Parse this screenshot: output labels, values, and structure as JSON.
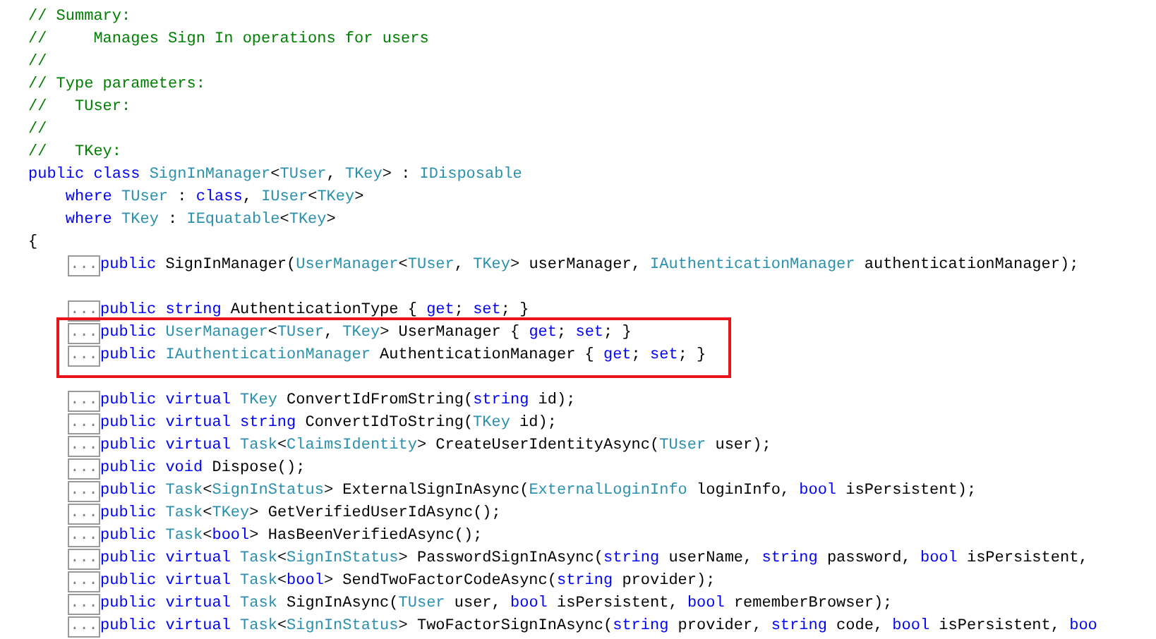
{
  "lines": [
    {
      "kind": "code",
      "tokens": [
        {
          "kind": "comment",
          "text": "// Summary:"
        }
      ]
    },
    {
      "kind": "code",
      "tokens": [
        {
          "kind": "comment",
          "text": "//     Manages Sign In operations for users"
        }
      ]
    },
    {
      "kind": "code",
      "tokens": [
        {
          "kind": "comment",
          "text": "//"
        }
      ]
    },
    {
      "kind": "code",
      "tokens": [
        {
          "kind": "comment",
          "text": "// Type parameters:"
        }
      ]
    },
    {
      "kind": "code",
      "tokens": [
        {
          "kind": "comment",
          "text": "//   TUser:"
        }
      ]
    },
    {
      "kind": "code",
      "tokens": [
        {
          "kind": "comment",
          "text": "//"
        }
      ]
    },
    {
      "kind": "code",
      "tokens": [
        {
          "kind": "comment",
          "text": "//   TKey:"
        }
      ]
    },
    {
      "kind": "code",
      "tokens": [
        {
          "kind": "keyword",
          "text": "public class "
        },
        {
          "kind": "type",
          "text": "SignInManager"
        },
        {
          "kind": "text",
          "text": "<"
        },
        {
          "kind": "type",
          "text": "TUser"
        },
        {
          "kind": "text",
          "text": ", "
        },
        {
          "kind": "type",
          "text": "TKey"
        },
        {
          "kind": "text",
          "text": "> : "
        },
        {
          "kind": "type",
          "text": "IDisposable"
        }
      ]
    },
    {
      "kind": "code",
      "tokens": [
        {
          "kind": "keyword",
          "text": "    where "
        },
        {
          "kind": "type",
          "text": "TUser"
        },
        {
          "kind": "text",
          "text": " : "
        },
        {
          "kind": "keyword",
          "text": "class"
        },
        {
          "kind": "text",
          "text": ", "
        },
        {
          "kind": "type",
          "text": "IUser"
        },
        {
          "kind": "text",
          "text": "<"
        },
        {
          "kind": "type",
          "text": "TKey"
        },
        {
          "kind": "text",
          "text": ">"
        }
      ]
    },
    {
      "kind": "code",
      "tokens": [
        {
          "kind": "keyword",
          "text": "    where "
        },
        {
          "kind": "type",
          "text": "TKey"
        },
        {
          "kind": "text",
          "text": " : "
        },
        {
          "kind": "type",
          "text": "IEquatable"
        },
        {
          "kind": "text",
          "text": "<"
        },
        {
          "kind": "type",
          "text": "TKey"
        },
        {
          "kind": "text",
          "text": ">"
        }
      ]
    },
    {
      "kind": "code",
      "tokens": [
        {
          "kind": "text",
          "text": "{"
        }
      ]
    },
    {
      "kind": "code",
      "fold": "...",
      "highlighted": false,
      "tokens": [
        {
          "kind": "keyword",
          "text": "public"
        },
        {
          "kind": "text",
          "text": " SignInManager("
        },
        {
          "kind": "type",
          "text": "UserManager"
        },
        {
          "kind": "text",
          "text": "<"
        },
        {
          "kind": "type",
          "text": "TUser"
        },
        {
          "kind": "text",
          "text": ", "
        },
        {
          "kind": "type",
          "text": "TKey"
        },
        {
          "kind": "text",
          "text": "> userManager, "
        },
        {
          "kind": "type",
          "text": "IAuthenticationManager"
        },
        {
          "kind": "text",
          "text": " authenticationManager);"
        }
      ]
    },
    {
      "kind": "blank"
    },
    {
      "kind": "code",
      "fold": "...",
      "highlighted": false,
      "tokens": [
        {
          "kind": "keyword",
          "text": "public string"
        },
        {
          "kind": "text",
          "text": " AuthenticationType { "
        },
        {
          "kind": "keyword",
          "text": "get"
        },
        {
          "kind": "text",
          "text": "; "
        },
        {
          "kind": "keyword",
          "text": "set"
        },
        {
          "kind": "text",
          "text": "; }"
        }
      ]
    },
    {
      "kind": "code",
      "fold": "...",
      "highlighted": true,
      "tokens": [
        {
          "kind": "keyword",
          "text": "public "
        },
        {
          "kind": "type",
          "text": "UserManager"
        },
        {
          "kind": "text",
          "text": "<"
        },
        {
          "kind": "type",
          "text": "TUser"
        },
        {
          "kind": "text",
          "text": ", "
        },
        {
          "kind": "type",
          "text": "TKey"
        },
        {
          "kind": "text",
          "text": "> UserManager { "
        },
        {
          "kind": "keyword",
          "text": "get"
        },
        {
          "kind": "text",
          "text": "; "
        },
        {
          "kind": "keyword",
          "text": "set"
        },
        {
          "kind": "text",
          "text": "; }"
        }
      ]
    },
    {
      "kind": "code",
      "fold": "...",
      "highlighted": true,
      "tokens": [
        {
          "kind": "keyword",
          "text": "public "
        },
        {
          "kind": "type",
          "text": "IAuthenticationManager"
        },
        {
          "kind": "text",
          "text": " AuthenticationManager { "
        },
        {
          "kind": "keyword",
          "text": "get"
        },
        {
          "kind": "text",
          "text": "; "
        },
        {
          "kind": "keyword",
          "text": "set"
        },
        {
          "kind": "text",
          "text": "; }"
        }
      ]
    },
    {
      "kind": "blank"
    },
    {
      "kind": "code",
      "fold": "...",
      "highlighted": false,
      "tokens": [
        {
          "kind": "keyword",
          "text": "public virtual "
        },
        {
          "kind": "type",
          "text": "TKey"
        },
        {
          "kind": "text",
          "text": " ConvertIdFromString("
        },
        {
          "kind": "keyword",
          "text": "string"
        },
        {
          "kind": "text",
          "text": " id);"
        }
      ]
    },
    {
      "kind": "code",
      "fold": "...",
      "highlighted": false,
      "tokens": [
        {
          "kind": "keyword",
          "text": "public virtual string"
        },
        {
          "kind": "text",
          "text": " ConvertIdToString("
        },
        {
          "kind": "type",
          "text": "TKey"
        },
        {
          "kind": "text",
          "text": " id);"
        }
      ]
    },
    {
      "kind": "code",
      "fold": "...",
      "highlighted": false,
      "tokens": [
        {
          "kind": "keyword",
          "text": "public virtual "
        },
        {
          "kind": "type",
          "text": "Task"
        },
        {
          "kind": "text",
          "text": "<"
        },
        {
          "kind": "type",
          "text": "ClaimsIdentity"
        },
        {
          "kind": "text",
          "text": "> CreateUserIdentityAsync("
        },
        {
          "kind": "type",
          "text": "TUser"
        },
        {
          "kind": "text",
          "text": " user);"
        }
      ]
    },
    {
      "kind": "code",
      "fold": "...",
      "highlighted": false,
      "tokens": [
        {
          "kind": "keyword",
          "text": "public void"
        },
        {
          "kind": "text",
          "text": " Dispose();"
        }
      ]
    },
    {
      "kind": "code",
      "fold": "...",
      "highlighted": false,
      "tokens": [
        {
          "kind": "keyword",
          "text": "public "
        },
        {
          "kind": "type",
          "text": "Task"
        },
        {
          "kind": "text",
          "text": "<"
        },
        {
          "kind": "type",
          "text": "SignInStatus"
        },
        {
          "kind": "text",
          "text": "> ExternalSignInAsync("
        },
        {
          "kind": "type",
          "text": "ExternalLoginInfo"
        },
        {
          "kind": "text",
          "text": " loginInfo, "
        },
        {
          "kind": "keyword",
          "text": "bool"
        },
        {
          "kind": "text",
          "text": " isPersistent);"
        }
      ]
    },
    {
      "kind": "code",
      "fold": "...",
      "highlighted": false,
      "tokens": [
        {
          "kind": "keyword",
          "text": "public "
        },
        {
          "kind": "type",
          "text": "Task"
        },
        {
          "kind": "text",
          "text": "<"
        },
        {
          "kind": "type",
          "text": "TKey"
        },
        {
          "kind": "text",
          "text": "> GetVerifiedUserIdAsync();"
        }
      ]
    },
    {
      "kind": "code",
      "fold": "...",
      "highlighted": false,
      "tokens": [
        {
          "kind": "keyword",
          "text": "public "
        },
        {
          "kind": "type",
          "text": "Task"
        },
        {
          "kind": "text",
          "text": "<"
        },
        {
          "kind": "keyword",
          "text": "bool"
        },
        {
          "kind": "text",
          "text": "> HasBeenVerifiedAsync();"
        }
      ]
    },
    {
      "kind": "code",
      "fold": "...",
      "highlighted": false,
      "tokens": [
        {
          "kind": "keyword",
          "text": "public virtual "
        },
        {
          "kind": "type",
          "text": "Task"
        },
        {
          "kind": "text",
          "text": "<"
        },
        {
          "kind": "type",
          "text": "SignInStatus"
        },
        {
          "kind": "text",
          "text": "> PasswordSignInAsync("
        },
        {
          "kind": "keyword",
          "text": "string"
        },
        {
          "kind": "text",
          "text": " userName, "
        },
        {
          "kind": "keyword",
          "text": "string"
        },
        {
          "kind": "text",
          "text": " password, "
        },
        {
          "kind": "keyword",
          "text": "bool"
        },
        {
          "kind": "text",
          "text": " isPersistent,"
        }
      ]
    },
    {
      "kind": "code",
      "fold": "...",
      "highlighted": false,
      "tokens": [
        {
          "kind": "keyword",
          "text": "public virtual "
        },
        {
          "kind": "type",
          "text": "Task"
        },
        {
          "kind": "text",
          "text": "<"
        },
        {
          "kind": "keyword",
          "text": "bool"
        },
        {
          "kind": "text",
          "text": "> SendTwoFactorCodeAsync("
        },
        {
          "kind": "keyword",
          "text": "string"
        },
        {
          "kind": "text",
          "text": " provider);"
        }
      ]
    },
    {
      "kind": "code",
      "fold": "...",
      "highlighted": false,
      "tokens": [
        {
          "kind": "keyword",
          "text": "public virtual "
        },
        {
          "kind": "type",
          "text": "Task"
        },
        {
          "kind": "text",
          "text": " SignInAsync("
        },
        {
          "kind": "type",
          "text": "TUser"
        },
        {
          "kind": "text",
          "text": " user, "
        },
        {
          "kind": "keyword",
          "text": "bool"
        },
        {
          "kind": "text",
          "text": " isPersistent, "
        },
        {
          "kind": "keyword",
          "text": "bool"
        },
        {
          "kind": "text",
          "text": " rememberBrowser);"
        }
      ]
    },
    {
      "kind": "code",
      "fold": "...",
      "highlighted": false,
      "tokens": [
        {
          "kind": "keyword",
          "text": "public virtual "
        },
        {
          "kind": "type",
          "text": "Task"
        },
        {
          "kind": "text",
          "text": "<"
        },
        {
          "kind": "type",
          "text": "SignInStatus"
        },
        {
          "kind": "text",
          "text": "> TwoFactorSignInAsync("
        },
        {
          "kind": "keyword",
          "text": "string"
        },
        {
          "kind": "text",
          "text": " provider, "
        },
        {
          "kind": "keyword",
          "text": "string"
        },
        {
          "kind": "text",
          "text": " code, "
        },
        {
          "kind": "keyword",
          "text": "bool"
        },
        {
          "kind": "text",
          "text": " isPersistent, "
        },
        {
          "kind": "keyword",
          "text": "boo"
        }
      ]
    }
  ]
}
